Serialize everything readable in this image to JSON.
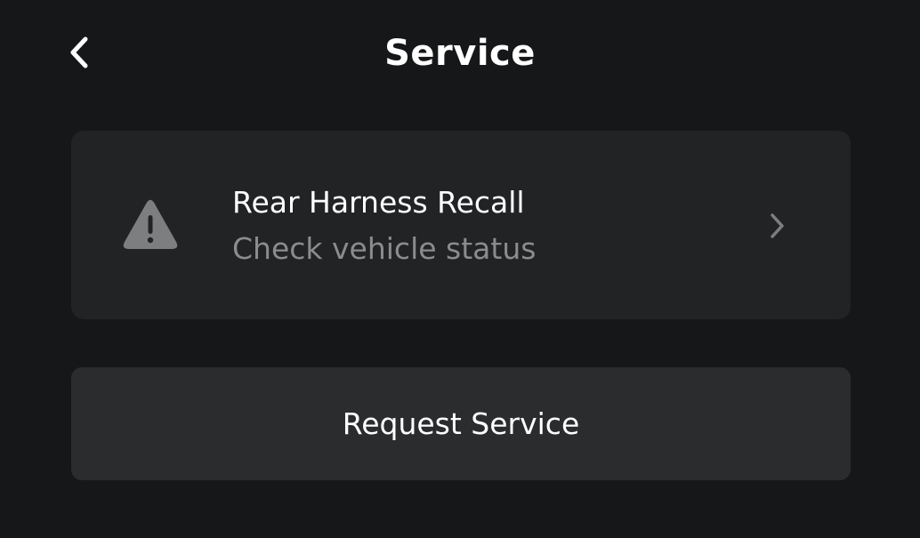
{
  "header": {
    "back_icon": "chevron-left-icon",
    "title": "Service"
  },
  "alert_card": {
    "icon": "warning-triangle-icon",
    "title": "Rear Harness Recall",
    "subtitle": "Check vehicle status",
    "chevron_icon": "chevron-right-icon"
  },
  "actions": {
    "request_service_label": "Request Service"
  },
  "colors": {
    "background": "#161719",
    "card": "#222325",
    "button": "#2b2c2e",
    "text_primary": "#ffffff",
    "text_secondary": "#8b8c8e",
    "icon_gray": "#7d7e80"
  }
}
